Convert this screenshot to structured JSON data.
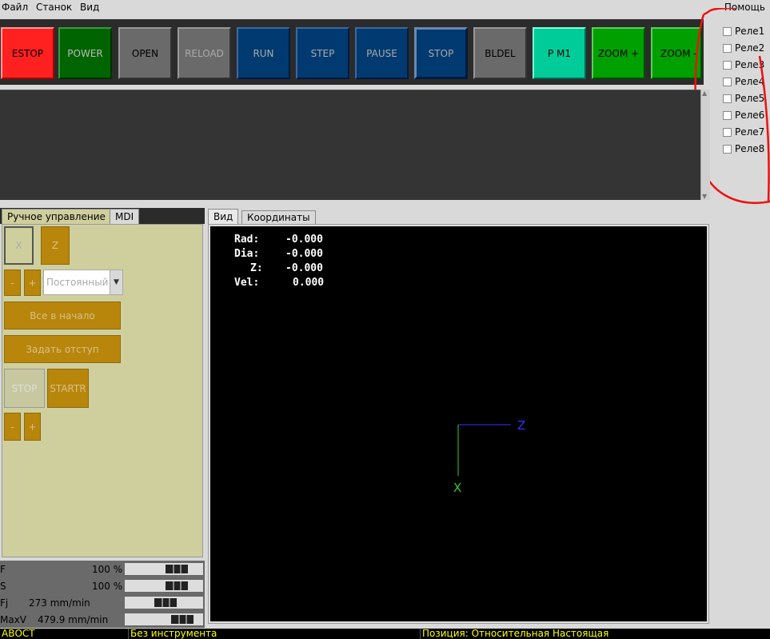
{
  "menu": {
    "file": "Файл",
    "machine": "Станок",
    "view": "Вид",
    "help": "Помощь"
  },
  "toolbar": {
    "estop": "ESTOP",
    "power": "POWER",
    "open": "OPEN",
    "reload": "RELOAD",
    "run": "RUN",
    "step": "STEP",
    "pause": "PAUSE",
    "stop": "STOP",
    "bldel": "BLDEL",
    "pm1": "P M1",
    "zoom_in": "ZOOM +",
    "zoom_out": "ZOOM -"
  },
  "relays": [
    "Реле1",
    "Реле2",
    "Реле3",
    "Реле4",
    "Реле5",
    "Реле6",
    "Реле7",
    "Реле8"
  ],
  "left_tabs": {
    "manual": "Ручное управление",
    "mdi": "MDI"
  },
  "manual": {
    "axis_x": "X",
    "axis_z": "Z",
    "jog_minus": "-",
    "jog_plus": "+",
    "jog_mode": "Постоянный",
    "home_all": "Все в начало",
    "touch_off": "Задать отступ",
    "spindle_stop": "STOP",
    "spindle_start": "STARTR",
    "spindle_minus": "-",
    "spindle_plus": "+"
  },
  "overrides": [
    {
      "label": "F",
      "value": "100 %",
      "level": 0.75
    },
    {
      "label": "S",
      "value": "100 %",
      "level": 0.75
    },
    {
      "label": "Fj",
      "value": "273 mm/min",
      "level": 0.55
    },
    {
      "label": "MaxV",
      "value": "479.9 mm/min",
      "level": 0.85
    }
  ],
  "view_tabs": {
    "preview": "Вид",
    "coordinates": "Координаты"
  },
  "dro": [
    {
      "label": "Rad:",
      "value": "-0.000"
    },
    {
      "label": "Dia:",
      "value": "-0.000"
    },
    {
      "label": "Z:",
      "value": "-0.000"
    },
    {
      "label": "Vel:",
      "value": "0.000"
    }
  ],
  "axes": {
    "z_label": "Z",
    "x_label": "X",
    "z_color": "#3333ff",
    "x_color": "#33cc33"
  },
  "status": {
    "state": "АВОСТ",
    "tool": "Без инструмента",
    "position": "Позиция: Относительная Настоящая"
  },
  "colors": {
    "estop": "#ff2020",
    "power": "#006400",
    "run": "#003a70",
    "pm1": "#00cc99",
    "zoom": "#00a000",
    "status_text": "#ffff00"
  }
}
